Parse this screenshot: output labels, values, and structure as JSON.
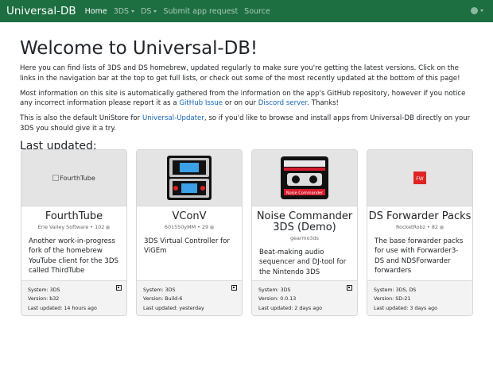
{
  "navbar": {
    "brand": "Universal-DB",
    "items": [
      {
        "label": "Home"
      },
      {
        "label": "3DS"
      },
      {
        "label": "DS"
      },
      {
        "label": "Submit app request"
      },
      {
        "label": "Source"
      }
    ]
  },
  "main": {
    "heading": "Welcome to Universal-DB!",
    "intro": "Here you can find lists of 3DS and DS homebrew, updated regularly to make sure you're getting the latest versions. Click on the links in the navigation bar at the top to get full lists, or check out some of the most recently updated at the bottom of this page!",
    "info_before": "Most information on this site is automatically gathered from the information on the app's GitHub repository, however if you notice any incorrect information please report it as a ",
    "info_link1": "GitHub Issue",
    "info_mid": " or on our ",
    "info_link2": "Discord server",
    "info_after": ". Thanks!",
    "unistore_before": "This is also the default UniStore for ",
    "unistore_link": "Universal-Updater",
    "unistore_after": ", so if you'd like to browse and install apps from Universal-DB directly on your 3DS you should give it a try.",
    "last_updated_heading": "Last updated:"
  },
  "cards": [
    {
      "image_alt": "FourthTube",
      "title": "FourthTube",
      "author": "Erie Valley Software • 102",
      "description": "Another work-in-progress fork of the homebrew YouTube client for the 3DS called ThirdTube",
      "system": "System: 3DS",
      "version": "Version: b32",
      "updated": "Last updated: 14 hours ago"
    },
    {
      "title": "VConV",
      "author": "601550yMM • 29",
      "description": "3DS Virtual Controller for ViGEm",
      "system": "System: 3DS",
      "version": "Version: Build-6",
      "updated": "Last updated: yesterday"
    },
    {
      "title": "Noise Commander 3DS (Demo)",
      "author": "gearmo3ds",
      "description": "Beat-making audio sequencer and DJ-tool for the Nintendo 3DS",
      "cassette_label": "Noise Commander",
      "system": "System: 3DS",
      "version": "Version: 0.0.13",
      "updated": "Last updated: 2 days ago"
    },
    {
      "title": "DS Forwarder Packs",
      "author": "RocketRobz • 82",
      "description": "The base forwarder packs for use with Forwarder3-DS and NDSForwarder forwarders",
      "icon_text": "FW",
      "system": "System: 3DS, DS",
      "version": "Version: SD-21",
      "updated": "Last updated: 3 days ago"
    }
  ],
  "colors": {
    "navbar": "#1d6f42",
    "link": "#1565c0",
    "card_image_bg": "#e4e4e4"
  }
}
